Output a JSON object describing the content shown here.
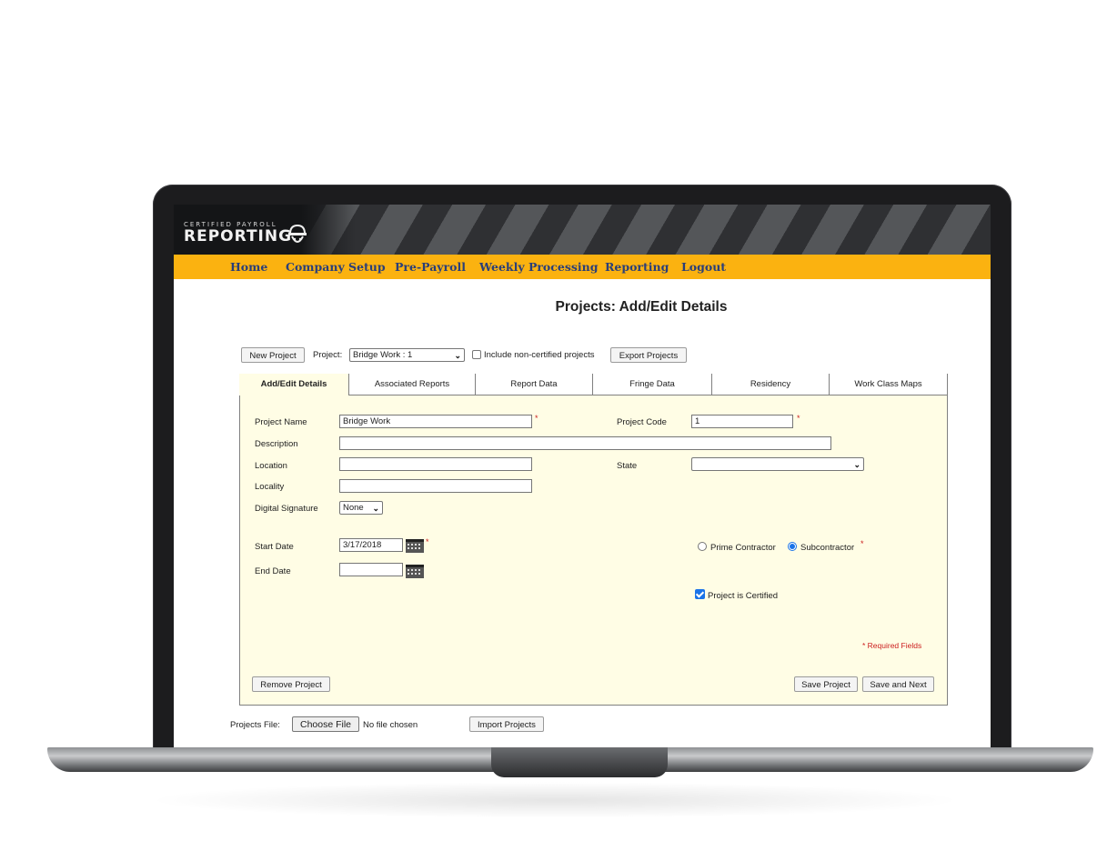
{
  "logo": {
    "top_line": "CERTIFIED PAYROLL",
    "main_line": "REPORTING"
  },
  "nav": [
    "Home",
    "Company Setup",
    "Pre-Payroll",
    "Weekly Processing",
    "Reporting",
    "Logout"
  ],
  "page_title": "Projects: Add/Edit Details",
  "toolbar": {
    "new_project": "New Project",
    "project_label": "Project:",
    "project_value": "Bridge Work : 1",
    "include_noncertified": "Include non-certified projects",
    "export_projects": "Export Projects"
  },
  "tabs": [
    "Add/Edit Details",
    "Associated Reports",
    "Report Data",
    "Fringe Data",
    "Residency",
    "Work Class Maps"
  ],
  "form": {
    "project_name_label": "Project Name",
    "project_name_value": "Bridge Work",
    "project_code_label": "Project Code",
    "project_code_value": "1",
    "description_label": "Description",
    "description_value": "",
    "location_label": "Location",
    "location_value": "",
    "state_label": "State",
    "state_value": "",
    "locality_label": "Locality",
    "locality_value": "",
    "digital_signature_label": "Digital Signature",
    "digital_signature_value": "None",
    "start_date_label": "Start Date",
    "start_date_value": "3/17/2018",
    "end_date_label": "End Date",
    "end_date_value": "",
    "prime_contractor": "Prime Contractor",
    "subcontractor": "Subcontractor",
    "contractor_type_selected": "Subcontractor",
    "project_certified_label": "Project is Certified",
    "project_certified_checked": true,
    "required_star": "*",
    "required_note": "* Required Fields",
    "remove_project": "Remove Project",
    "save_project": "Save Project",
    "save_and_next": "Save and Next"
  },
  "import": {
    "projects_file_label": "Projects File:",
    "choose_file": "Choose File",
    "no_file": "No file chosen",
    "import_projects": "Import Projects"
  },
  "colors": {
    "nav_bg": "#fbb210",
    "nav_text": "#2b3f78",
    "panel_bg": "#fffde5",
    "required": "#cc2020",
    "accent": "#1a73e8"
  }
}
